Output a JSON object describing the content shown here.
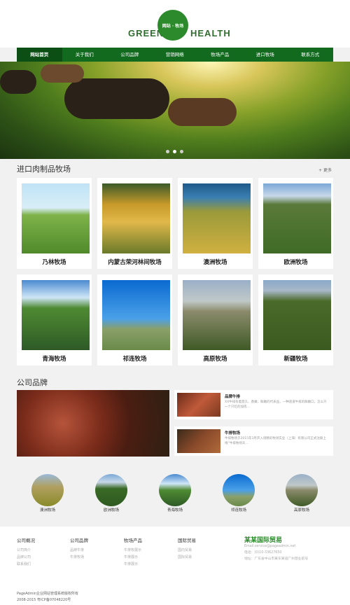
{
  "header": {
    "logo_left": "GREEN",
    "logo_right": "HEALTH",
    "badge_text": "网站 · 牧场"
  },
  "nav": {
    "items": [
      "网站首页",
      "关于我们",
      "公司品牌",
      "营销网络",
      "牧场产品",
      "进口牧场",
      "联系方式"
    ],
    "active_index": 0
  },
  "hero": {
    "slide_count": 3,
    "active_slide": 2
  },
  "ranch": {
    "title": "进口肉制品牧场",
    "more": "+ 更多",
    "items": [
      "乃林牧场",
      "内蒙古荣河林间牧场",
      "澳洲牧场",
      "欧洲牧场",
      "青海牧场",
      "祁连牧场",
      "高原牧场",
      "新疆牧场"
    ]
  },
  "brand": {
    "title": "公司品牌",
    "items": [
      {
        "title": "品牌牛排",
        "desc": "XX牛排有着悠久、香嫩、鲜嫩的代表品，一种道道牛排的鲜嫩口，怎么只一个只吃的加肉..."
      },
      {
        "title": "牛排牧场",
        "desc": "牛排牧场于2015年3月开入境精彩牧场实业（上海）有限公司正式注册上线“牛排牧场天..."
      }
    ]
  },
  "circles": {
    "items": [
      "澳洲牧场",
      "欧洲牧场",
      "青海牧场",
      "祁连牧场",
      "高原牧场"
    ]
  },
  "footer": {
    "columns": [
      {
        "title": "公司概况",
        "links": [
          "公司简介",
          "品牌公司",
          "联系我们"
        ]
      },
      {
        "title": "公司品牌",
        "links": [
          "品牌牛排",
          "牛排牧场"
        ]
      },
      {
        "title": "牧场产品",
        "links": [
          "牛排牧展示",
          "牛排展示",
          "牛排展示"
        ]
      },
      {
        "title": "国际贸易",
        "links": [
          "国内贸易",
          "国际贸易"
        ]
      }
    ],
    "brand": "某某国际贸易",
    "info": [
      "Email:service@pageadmin.net",
      "电话：(0)10-33627650",
      "地址：广东省中山市某东某道广州营业前号"
    ],
    "copyright": [
      "PageAdmin企业网站管理系统版权所有",
      "2008-2015 粤ICP备07048220号"
    ]
  },
  "colors": {
    "nav_green": "#126a1f",
    "brand_green": "#2a8a2a"
  }
}
